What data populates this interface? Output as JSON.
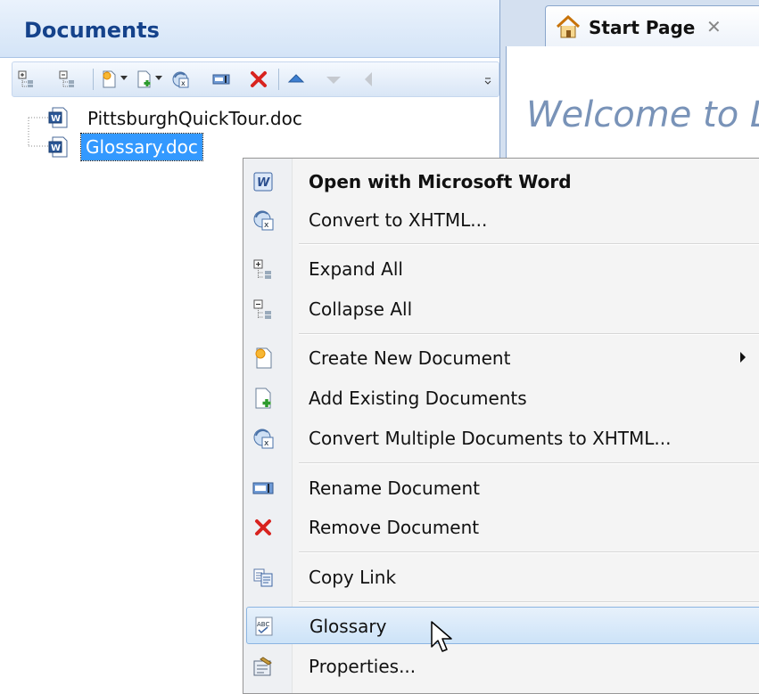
{
  "documents_pane": {
    "title": "Documents",
    "toolbar": {
      "icons": [
        "expand-all-icon",
        "collapse-all-icon",
        "create-new-document-icon",
        "add-existing-document-icon",
        "convert-to-xhtml-icon",
        "rename-icon",
        "remove-icon",
        "move-up-icon",
        "move-down-icon",
        "move-left-icon"
      ]
    },
    "tree": [
      {
        "label": "PittsburghQuickTour.doc",
        "selected": false
      },
      {
        "label": "Glossary.doc",
        "selected": true
      }
    ]
  },
  "start_page": {
    "tab_label": "Start Page",
    "close_glyph": "✕",
    "welcome_text": "Welcome to D"
  },
  "context_menu": {
    "items": [
      {
        "label": "Open with Microsoft Word",
        "icon": "word-icon",
        "bold": true
      },
      {
        "label": "Convert to XHTML...",
        "icon": "convert-xhtml-icon"
      },
      {
        "label": "Expand All",
        "icon": "expand-all-icon"
      },
      {
        "label": "Collapse All",
        "icon": "collapse-all-icon"
      },
      {
        "label": "Create New Document",
        "icon": "new-document-icon",
        "submenu": true
      },
      {
        "label": "Add Existing Documents",
        "icon": "add-documents-icon"
      },
      {
        "label": "Convert Multiple Documents to XHTML...",
        "icon": "convert-multiple-icon"
      },
      {
        "label": "Rename Document",
        "icon": "rename-icon"
      },
      {
        "label": "Remove Document",
        "icon": "remove-icon"
      },
      {
        "label": "Copy Link",
        "icon": "copy-link-icon"
      },
      {
        "label": "Glossary",
        "icon": "glossary-icon",
        "highlighted": true
      },
      {
        "label": "Properties...",
        "icon": "properties-icon"
      }
    ]
  },
  "colors": {
    "header_title": "#15428b",
    "selection": "#3399ff",
    "remove_red": "#d8231f",
    "menu_highlight": "#cde3f8"
  }
}
